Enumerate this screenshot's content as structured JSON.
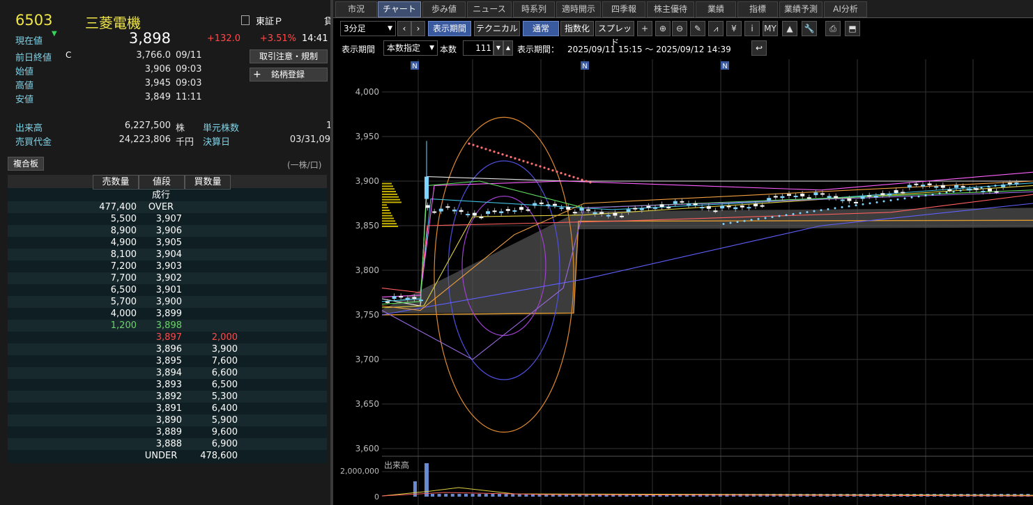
{
  "stock": {
    "code": "6503",
    "name": "三菱電機",
    "market": "東証Ｐ",
    "market_extra": "貸",
    "current_label": "現在値",
    "current_arrow": "▼",
    "current": "3,898",
    "change": "+132.0",
    "change_pct": "+3.51%",
    "time": "14:41",
    "prev_close_label": "前日終値",
    "prev_close_flag": "C",
    "prev_close": "3,766.0",
    "prev_close_date": "09/11",
    "open_label": "始値",
    "open": "3,906",
    "open_time": "09:03",
    "high_label": "高値",
    "high": "3,945",
    "high_time": "09:03",
    "low_label": "安値",
    "low": "3,849",
    "low_time": "11:11",
    "volume_label": "出来高",
    "volume": "6,227,500",
    "volume_unit": "株",
    "unit_shares_label": "単元株数",
    "unit_shares": "1",
    "turnover_label": "売買代金",
    "turnover": "24,223,806",
    "turnover_unit": "千円",
    "fiscal_label": "決算日",
    "fiscal": "03/31,09"
  },
  "buttons": {
    "caution": "取引注意・規制",
    "register_plus": "+",
    "register": "銘柄登録",
    "composite": "複合板",
    "unit_note": "(一株/口)"
  },
  "orderbook": {
    "headers": [
      "売数量",
      "値段",
      "買数量"
    ],
    "rows": [
      {
        "sell": "",
        "price": "成行",
        "buy": ""
      },
      {
        "sell": "477,400",
        "price": "OVER",
        "buy": ""
      },
      {
        "sell": "5,500",
        "price": "3,907",
        "buy": ""
      },
      {
        "sell": "8,900",
        "price": "3,906",
        "buy": ""
      },
      {
        "sell": "4,900",
        "price": "3,905",
        "buy": ""
      },
      {
        "sell": "8,100",
        "price": "3,904",
        "buy": ""
      },
      {
        "sell": "7,200",
        "price": "3,903",
        "buy": ""
      },
      {
        "sell": "7,700",
        "price": "3,902",
        "buy": ""
      },
      {
        "sell": "6,500",
        "price": "3,901",
        "buy": ""
      },
      {
        "sell": "5,700",
        "price": "3,900",
        "buy": ""
      },
      {
        "sell": "4,000",
        "price": "3,899",
        "buy": ""
      },
      {
        "sell": "1,200",
        "price": "3,898",
        "buy": ""
      },
      {
        "sell": "",
        "price": "3,897",
        "buy": "2,000"
      },
      {
        "sell": "",
        "price": "3,896",
        "buy": "3,900"
      },
      {
        "sell": "",
        "price": "3,895",
        "buy": "7,600"
      },
      {
        "sell": "",
        "price": "3,894",
        "buy": "6,600"
      },
      {
        "sell": "",
        "price": "3,893",
        "buy": "6,500"
      },
      {
        "sell": "",
        "price": "3,892",
        "buy": "5,300"
      },
      {
        "sell": "",
        "price": "3,891",
        "buy": "6,400"
      },
      {
        "sell": "",
        "price": "3,890",
        "buy": "5,900"
      },
      {
        "sell": "",
        "price": "3,889",
        "buy": "9,600"
      },
      {
        "sell": "",
        "price": "3,888",
        "buy": "6,900"
      },
      {
        "sell": "",
        "price": "UNDER",
        "buy": "478,600"
      }
    ]
  },
  "tabs": [
    "市況",
    "チャート",
    "歩み値",
    "ニュース",
    "時系列",
    "適時開示",
    "四季報",
    "株主優待",
    "業績",
    "指標",
    "業績予測",
    "AI分析"
  ],
  "toolbar": {
    "interval": "3分足",
    "prev": "‹",
    "next": "›",
    "period_btn": "表示期間",
    "technical_btn": "テクニカル",
    "normal_btn": "通常",
    "index_btn": "指数化",
    "spread_btn": "スプレッド",
    "icons": [
      "+",
      "⊕",
      "⊖",
      "✎",
      "⩘",
      "¥",
      "i",
      "MY",
      "▲",
      "🔧",
      "⎙",
      "⬒"
    ]
  },
  "period": {
    "label": "表示期間",
    "mode": "本数指定",
    "count_label": "本数",
    "count": "111",
    "range_label": "表示期間：",
    "range": "2025/09/11 15:15 ～ 2025/09/12 14:39",
    "return_icon": "↩"
  },
  "chart_data": {
    "type": "candlestick",
    "ylim": [
      3600,
      4000
    ],
    "y_ticks": [
      "4,000",
      "3,950",
      "3,900",
      "3,850",
      "3,800",
      "3,750",
      "3,700",
      "3,650",
      "3,600"
    ],
    "news_markers": [
      "N",
      "N",
      "N"
    ],
    "volume_label": "出来高",
    "volume_ticks": [
      "2,000,000",
      "0"
    ]
  }
}
